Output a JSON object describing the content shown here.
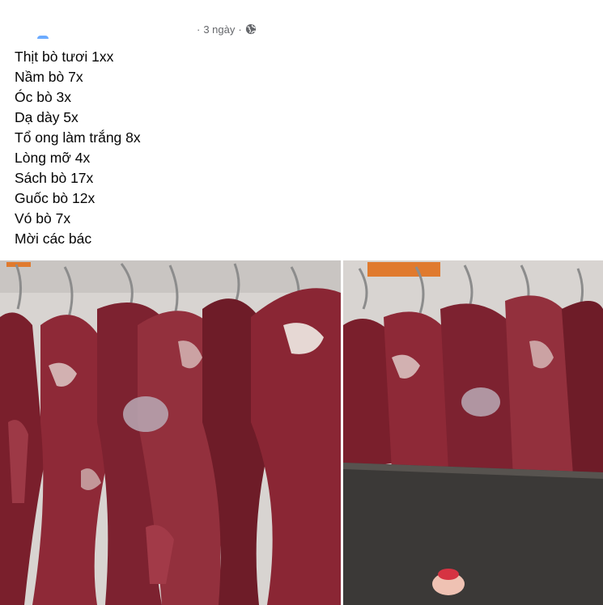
{
  "post": {
    "timestamp": "3 ngày",
    "separator_before": "·",
    "separator_after": "·",
    "privacy_icon": "globe-icon",
    "lines": [
      "Thịt bò tươi 1xx",
      "Nầm bò 7x",
      "Óc bò 3x",
      "Dạ dày 5x",
      "Tổ ong làm trắng 8x",
      "Lòng mỡ 4x",
      "Sách bò 17x",
      "Guốc bò 12x",
      "Vó bò 7x",
      "Mời các bác"
    ]
  },
  "photos": [
    {
      "subject": "hanging-beef-photo",
      "accent": "#8a2431"
    },
    {
      "subject": "hanging-beef-photo-with-cutting-board",
      "accent": "#8a2431"
    }
  ],
  "colors": {
    "meat_dark": "#6b1a26",
    "meat": "#8f2a38",
    "meat_light": "#b4505c",
    "fat": "#e8d9d6",
    "wall": "#d9d6d3",
    "board": "#3b3937",
    "text_secondary": "#65676b"
  }
}
